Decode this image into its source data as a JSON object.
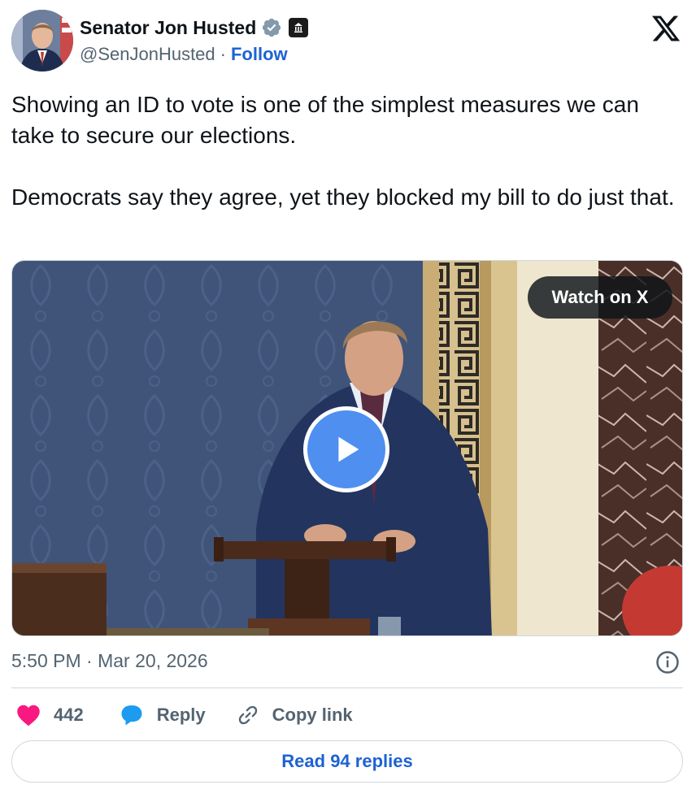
{
  "author": {
    "name": "Senator Jon Husted",
    "handle": "@SenJonHusted",
    "separator": "·",
    "follow_label": "Follow"
  },
  "tweet": {
    "paragraphs": [
      "Showing an ID to vote is one of the simplest measures we can take to secure our elections.",
      "Democrats say they agree, yet they blocked my bill to do just that."
    ]
  },
  "media": {
    "watch_label": "Watch on X"
  },
  "meta": {
    "time": "5:50 PM",
    "separator": "·",
    "date": "Mar 20, 2026"
  },
  "actions": {
    "likes": "442",
    "reply_label": "Reply",
    "copy_label": "Copy link"
  },
  "read_replies_label": "Read 94 replies",
  "colors": {
    "accent": "#1d62d4",
    "like": "#f91880",
    "reply_bubble": "#1d9bf0",
    "verified": "#829aab",
    "text_secondary": "#536471"
  },
  "icons": [
    "verified-badge-icon",
    "government-badge-icon",
    "x-logo-icon",
    "play-icon",
    "info-icon",
    "heart-icon",
    "reply-icon",
    "link-icon"
  ]
}
